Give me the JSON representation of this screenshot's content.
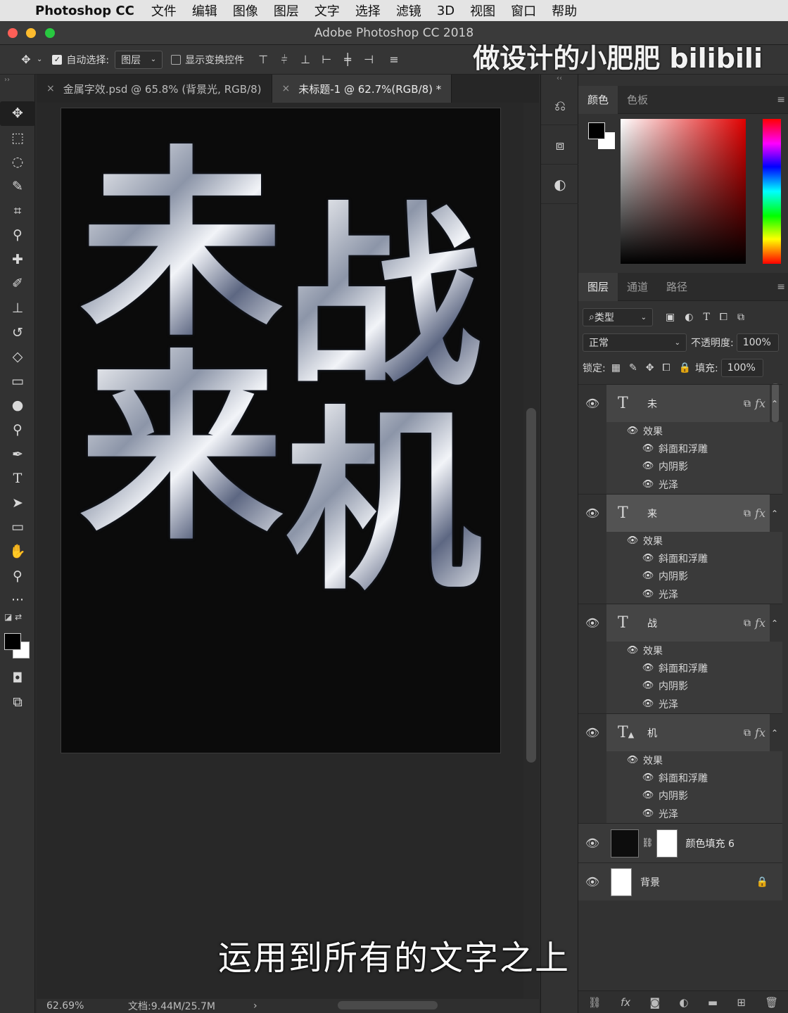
{
  "menubar": {
    "app": "Photoshop CC",
    "items": [
      "文件",
      "编辑",
      "图像",
      "图层",
      "文字",
      "选择",
      "滤镜",
      "3D",
      "视图",
      "窗口",
      "帮助"
    ]
  },
  "window": {
    "title": "Adobe Photoshop CC 2018"
  },
  "watermark": "做设计的小肥肥 bilibili",
  "options": {
    "auto_select_label": "自动选择:",
    "auto_select_value": "图层",
    "transform_label": "显示变换控件"
  },
  "tabs": [
    {
      "label": "金属字效.psd @ 65.8% (背景光, RGB/8)"
    },
    {
      "label": "未标题-1 @ 62.7%(RGB/8) *"
    }
  ],
  "artwork": {
    "chars": [
      "未",
      "战",
      "来",
      "机"
    ]
  },
  "status": {
    "zoom": "62.69%",
    "doc": "文档:9.44M/25.7M"
  },
  "subtitle": "运用到所有的文字之上",
  "color_panel": {
    "tabs": [
      "颜色",
      "色板"
    ],
    "fg": "#000000",
    "bg": "#ffffff"
  },
  "layers_panel": {
    "tabs": [
      "图层",
      "通道",
      "路径"
    ],
    "filter": "类型",
    "blend_mode": "正常",
    "opacity_label": "不透明度:",
    "opacity": "100%",
    "lock_label": "锁定:",
    "fill_label": "填充:",
    "fill": "100%",
    "layers": [
      {
        "name": "未",
        "effects_label": "效果",
        "effects": [
          "斜面和浮雕",
          "内阴影",
          "光泽"
        ]
      },
      {
        "name": "来",
        "effects_label": "效果",
        "effects": [
          "斜面和浮雕",
          "内阴影",
          "光泽"
        ]
      },
      {
        "name": "战",
        "effects_label": "效果",
        "effects": [
          "斜面和浮雕",
          "内阴影",
          "光泽"
        ]
      },
      {
        "name": "机",
        "effects_label": "效果",
        "effects": [
          "斜面和浮雕",
          "内阴影",
          "光泽"
        ]
      }
    ],
    "fill_layer": "颜色填充 6",
    "background_layer": "背景"
  }
}
